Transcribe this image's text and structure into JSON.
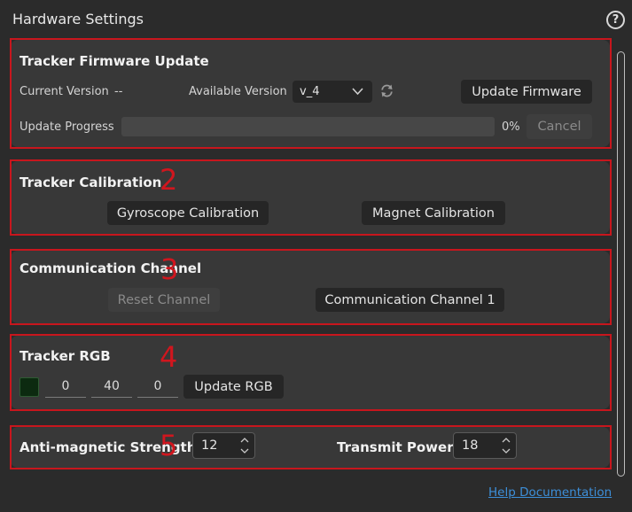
{
  "window": {
    "title": "Hardware Settings"
  },
  "firmware": {
    "title": "Tracker Firmware Update",
    "current_version_label": "Current Version",
    "current_version_value": "--",
    "available_version_label": "Available Version",
    "available_version_selected": "v_4",
    "update_button": "Update Firmware",
    "progress_label": "Update Progress",
    "progress_value": 0,
    "progress_text": "0%",
    "cancel_button": "Cancel"
  },
  "calibration": {
    "marker": "2",
    "title": "Tracker Calibration",
    "gyro_button": "Gyroscope Calibration",
    "magnet_button": "Magnet Calibration"
  },
  "channel": {
    "marker": "3",
    "title": "Communication Channel",
    "reset_button": "Reset Channel",
    "channel_button": "Communication Channel 1"
  },
  "rgb": {
    "marker": "4",
    "title": "Tracker RGB",
    "swatch_color": "#0c2a10",
    "r": "0",
    "g": "40",
    "b": "0",
    "update_button": "Update RGB"
  },
  "power": {
    "marker": "5",
    "strength_label": "Anti-magnetic Strength",
    "strength_value": "12",
    "transmit_label": "Transmit Power",
    "transmit_value": "18"
  },
  "footer": {
    "help_link": "Help Documentation"
  },
  "icons": {
    "help": "question-circle-icon",
    "refresh": "refresh-icon",
    "dropdown": "chevron-down-icon",
    "spinner": "spin-arrows-icon"
  },
  "colors": {
    "highlight_border": "#c8161d",
    "link": "#3d8fd9",
    "panel": "#383838",
    "background": "#2b2b2b"
  }
}
